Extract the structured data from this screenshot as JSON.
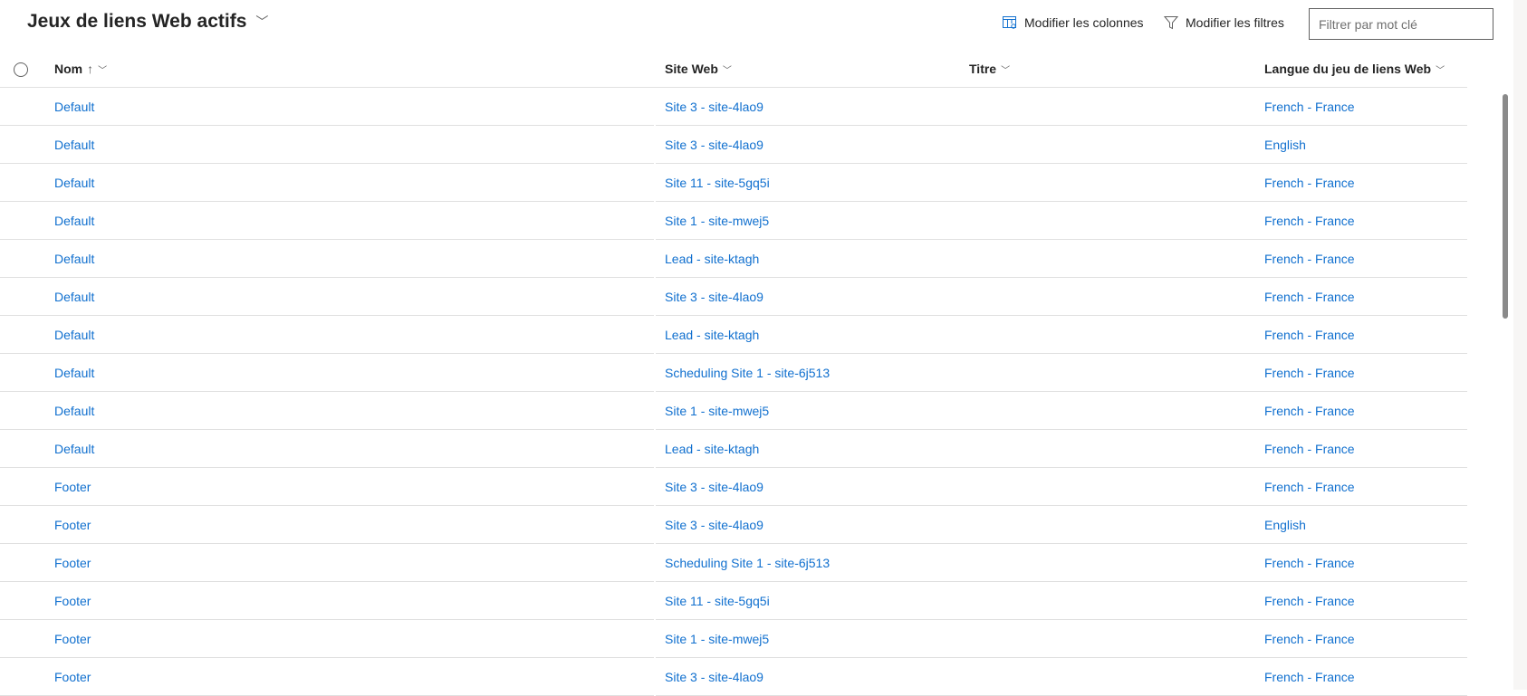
{
  "header": {
    "title": "Jeux de liens Web actifs",
    "edit_columns": "Modifier les colonnes",
    "edit_filters": "Modifier les filtres",
    "search_placeholder": "Filtrer par mot clé"
  },
  "columns": {
    "name": "Nom",
    "name_sort": "↑",
    "website": "Site Web",
    "title": "Titre",
    "language": "Langue du jeu de liens Web"
  },
  "colors": {
    "link": "#1170cf",
    "text": "#242424"
  },
  "rows": [
    {
      "name": "Default",
      "site": "Site 3 - site-4lao9",
      "title": "",
      "lang": "French - France"
    },
    {
      "name": "Default",
      "site": "Site 3 - site-4lao9",
      "title": "",
      "lang": "English"
    },
    {
      "name": "Default",
      "site": "Site 11 - site-5gq5i",
      "title": "",
      "lang": "French - France"
    },
    {
      "name": "Default",
      "site": "Site 1 - site-mwej5",
      "title": "",
      "lang": "French - France"
    },
    {
      "name": "Default",
      "site": "Lead - site-ktagh",
      "title": "",
      "lang": "French - France"
    },
    {
      "name": "Default",
      "site": "Site 3 - site-4lao9",
      "title": "",
      "lang": "French - France"
    },
    {
      "name": "Default",
      "site": "Lead - site-ktagh",
      "title": "",
      "lang": "French - France"
    },
    {
      "name": "Default",
      "site": "Scheduling Site 1 - site-6j513",
      "title": "",
      "lang": "French - France"
    },
    {
      "name": "Default",
      "site": "Site 1 - site-mwej5",
      "title": "",
      "lang": "French - France"
    },
    {
      "name": "Default",
      "site": "Lead - site-ktagh",
      "title": "",
      "lang": "French - France"
    },
    {
      "name": "Footer",
      "site": "Site 3 - site-4lao9",
      "title": "",
      "lang": "French - France"
    },
    {
      "name": "Footer",
      "site": "Site 3 - site-4lao9",
      "title": "",
      "lang": "English"
    },
    {
      "name": "Footer",
      "site": "Scheduling Site 1 - site-6j513",
      "title": "",
      "lang": "French - France"
    },
    {
      "name": "Footer",
      "site": "Site 11 - site-5gq5i",
      "title": "",
      "lang": "French - France"
    },
    {
      "name": "Footer",
      "site": "Site 1 - site-mwej5",
      "title": "",
      "lang": "French - France"
    },
    {
      "name": "Footer",
      "site": "Site 3 - site-4lao9",
      "title": "",
      "lang": "French - France"
    }
  ]
}
